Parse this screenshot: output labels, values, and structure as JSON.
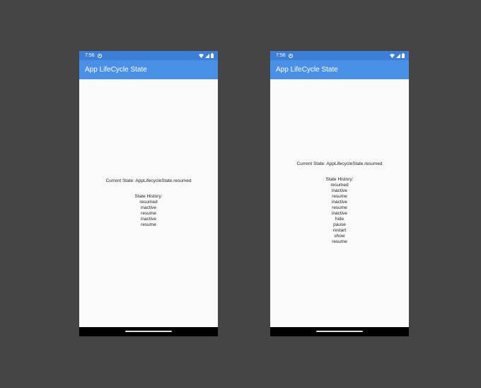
{
  "colors": {
    "background": "#454545",
    "status_bar": "#3c7fd8",
    "app_bar": "#4a90e6",
    "screen": "#fafafa",
    "nav_bar": "#000000"
  },
  "icons": [
    "do-not-disturb-icon",
    "wifi-icon",
    "cellular-signal-icon",
    "battery-icon"
  ],
  "phones": [
    {
      "status_bar": {
        "time": "7:56"
      },
      "app_bar": {
        "title": "App LifeCycle State"
      },
      "current_state": "Current State: AppLifecycleState.resumed",
      "history_heading": "State History:",
      "history": [
        "resumed",
        "inactive",
        "resume",
        "inactive",
        "resume"
      ]
    },
    {
      "status_bar": {
        "time": "7:56"
      },
      "app_bar": {
        "title": "App LifeCycle State"
      },
      "current_state": "Current State: AppLifecycleState.resumed",
      "history_heading": "State History:",
      "history": [
        "resumed",
        "inactive",
        "resume",
        "inactive",
        "resume",
        "inactive",
        "hide",
        "pause",
        "restart",
        "show",
        "resume"
      ]
    }
  ]
}
